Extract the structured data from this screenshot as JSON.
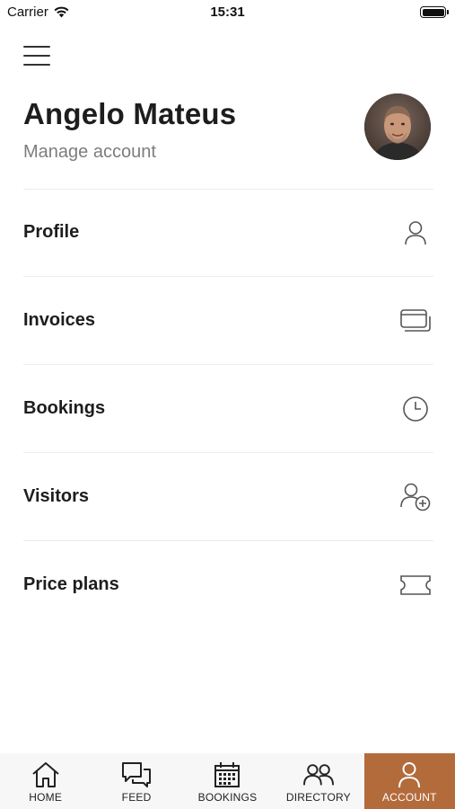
{
  "status_bar": {
    "carrier": "Carrier",
    "time": "15:31",
    "battery_level": 1.0
  },
  "header": {
    "menu_icon": "hamburger-menu-icon",
    "user_name": "Angelo Mateus",
    "manage_account": "Manage account",
    "avatar": "user-avatar-photo"
  },
  "menu": {
    "items": [
      {
        "label": "Profile",
        "icon": "person-icon"
      },
      {
        "label": "Invoices",
        "icon": "cards-icon"
      },
      {
        "label": "Bookings",
        "icon": "clock-icon"
      },
      {
        "label": "Visitors",
        "icon": "person-add-icon"
      },
      {
        "label": "Price plans",
        "icon": "ticket-icon"
      }
    ]
  },
  "tab_bar": {
    "active_tab": "ACCOUNT",
    "accent_color": "#b36b3b",
    "tabs": [
      {
        "label": "HOME",
        "icon": "home-icon"
      },
      {
        "label": "FEED",
        "icon": "chat-bubbles-icon"
      },
      {
        "label": "BOOKINGS",
        "icon": "calendar-icon"
      },
      {
        "label": "DIRECTORY",
        "icon": "people-icon"
      },
      {
        "label": "ACCOUNT",
        "icon": "person-icon"
      }
    ]
  }
}
